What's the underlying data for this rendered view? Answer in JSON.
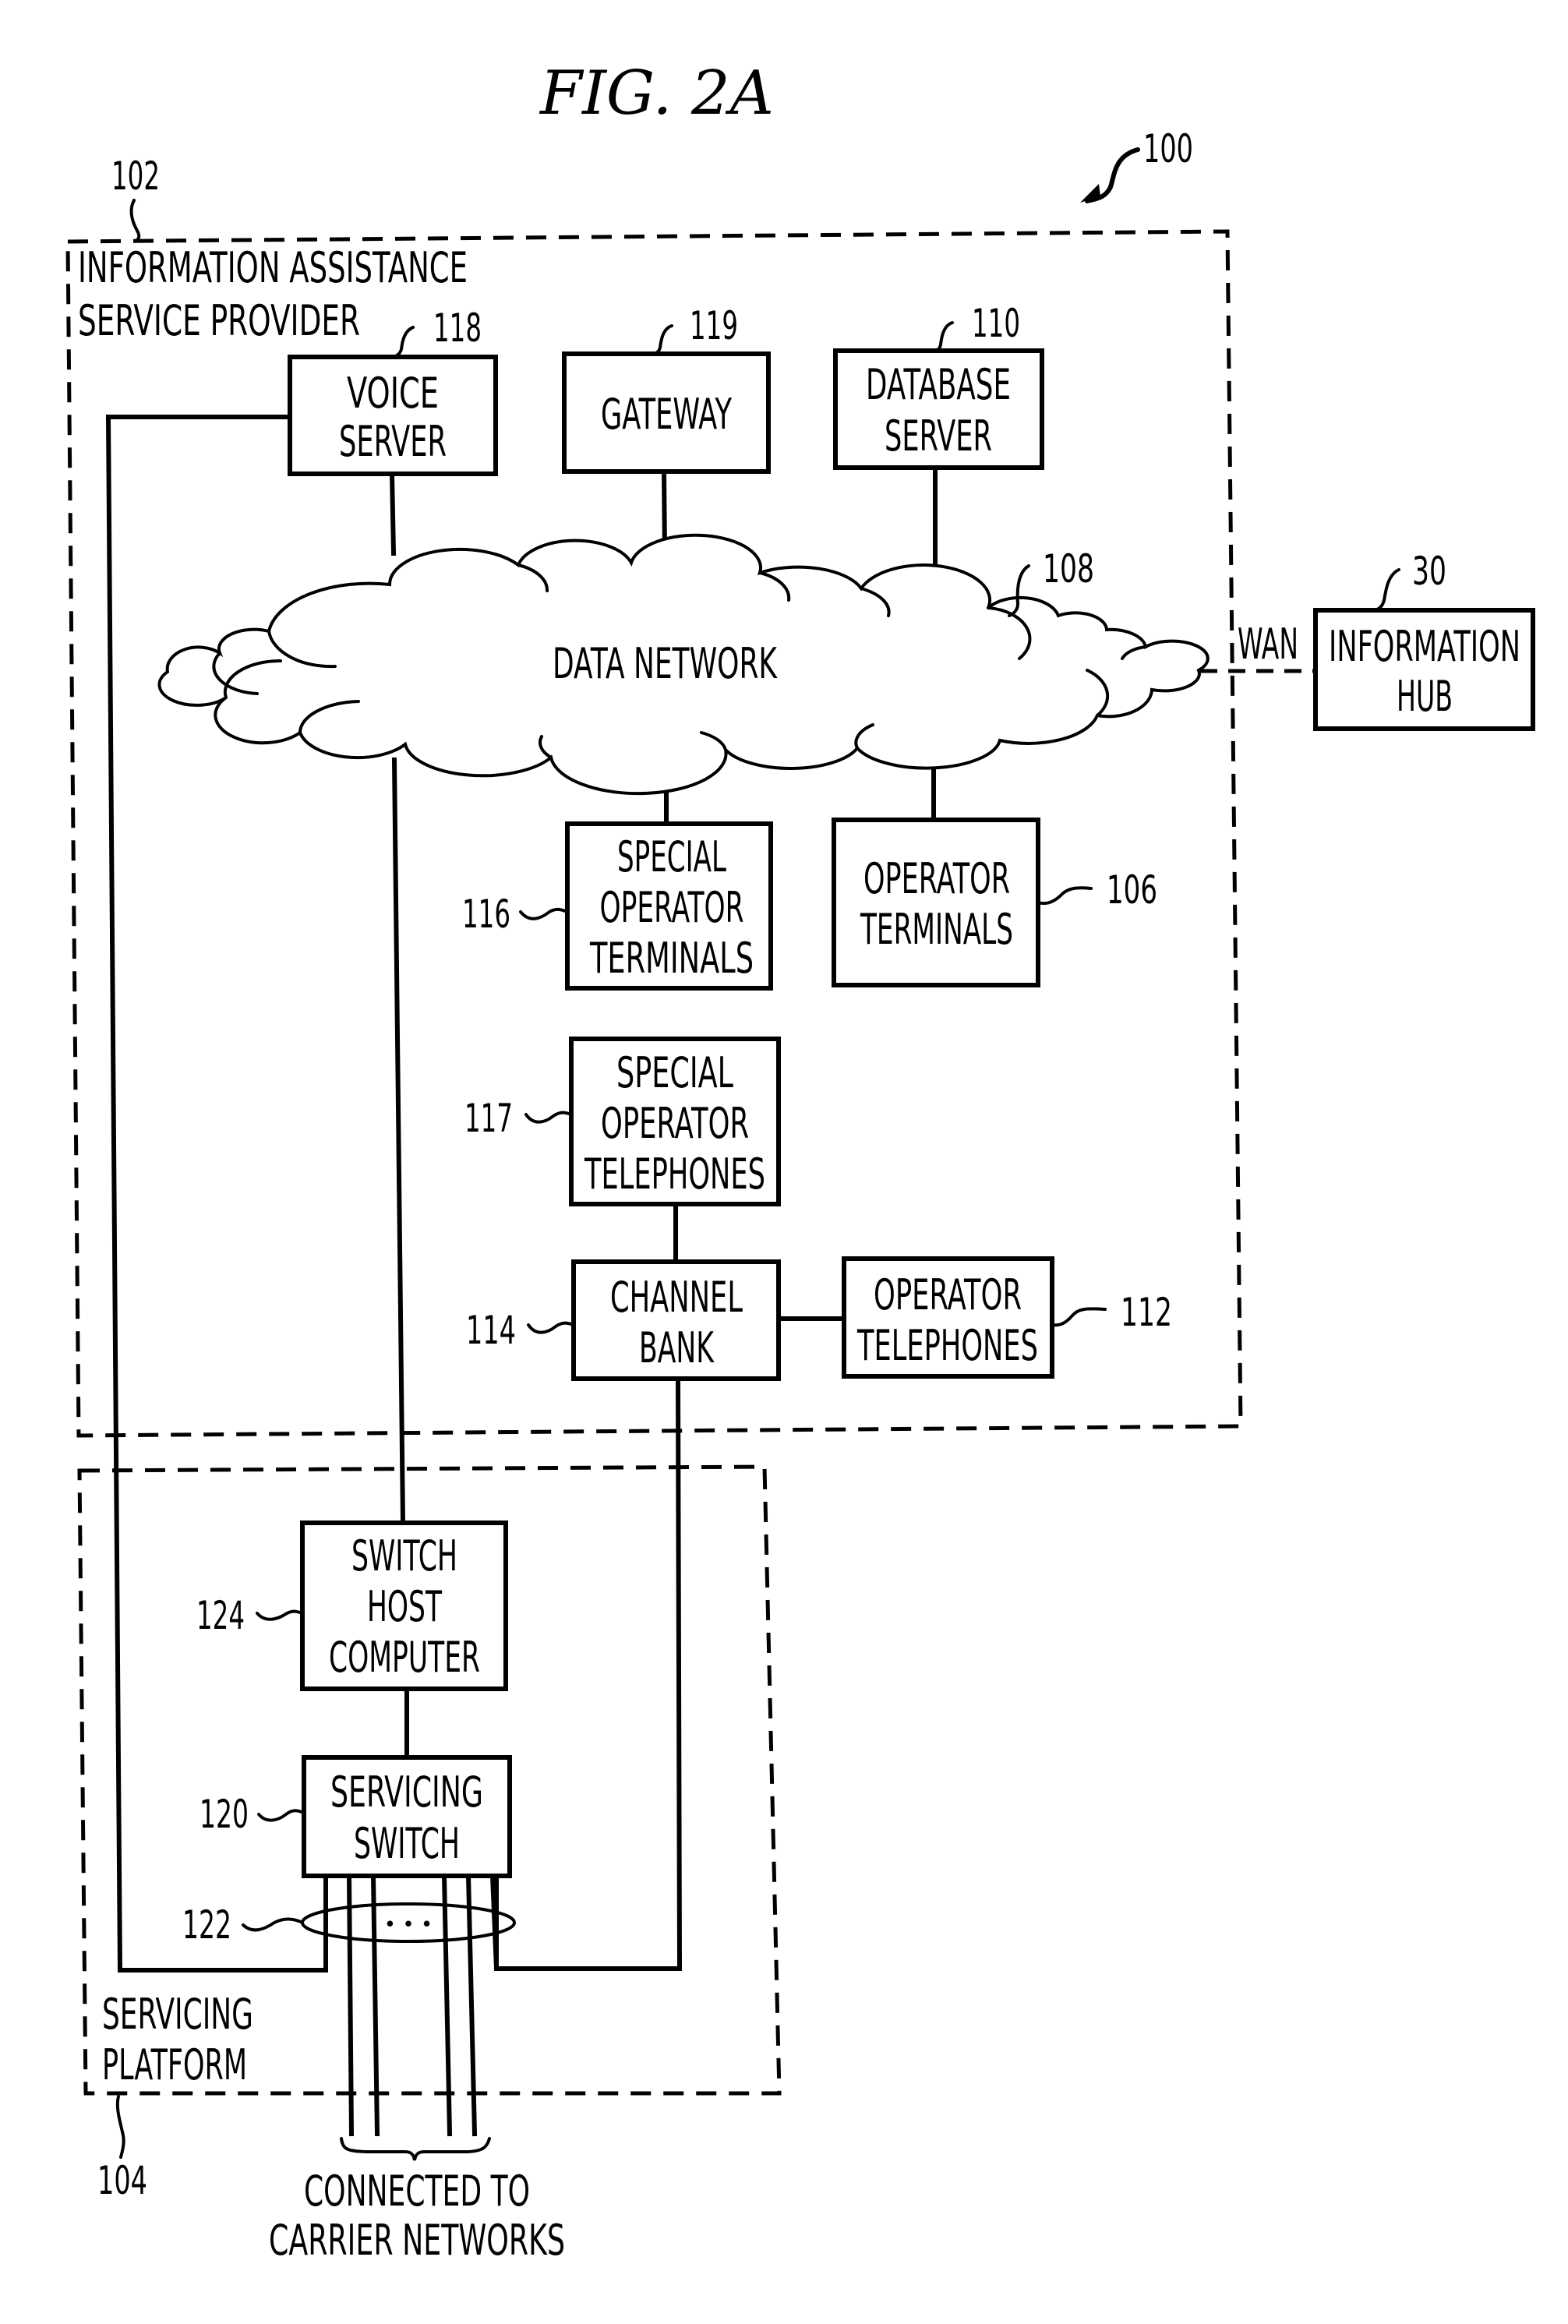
{
  "figure": {
    "title": "FIG. 2A",
    "system_ref": "100"
  },
  "regions": {
    "provider": {
      "ref": "102",
      "label_line1": "INFORMATION ASSISTANCE",
      "label_line2": "SERVICE PROVIDER"
    },
    "platform": {
      "ref": "104",
      "label_line1": "SERVICING",
      "label_line2": "PLATFORM"
    }
  },
  "nodes": {
    "voice_server": {
      "ref": "118",
      "lines": [
        "VOICE",
        "SERVER"
      ]
    },
    "gateway": {
      "ref": "119",
      "lines": [
        "GATEWAY"
      ]
    },
    "database_server": {
      "ref": "110",
      "lines": [
        "DATABASE",
        "SERVER"
      ]
    },
    "data_network": {
      "ref": "108",
      "lines": [
        "DATA NETWORK"
      ]
    },
    "information_hub": {
      "ref": "30",
      "lines": [
        "INFORMATION",
        "HUB"
      ]
    },
    "special_operator_terminals": {
      "ref": "116",
      "lines": [
        "SPECIAL",
        "OPERATOR",
        "TERMINALS"
      ]
    },
    "operator_terminals": {
      "ref": "106",
      "lines": [
        "OPERATOR",
        "TERMINALS"
      ]
    },
    "special_operator_telephones": {
      "ref": "117",
      "lines": [
        "SPECIAL",
        "OPERATOR",
        "TELEPHONES"
      ]
    },
    "channel_bank": {
      "ref": "114",
      "lines": [
        "CHANNEL",
        "BANK"
      ]
    },
    "operator_telephones": {
      "ref": "112",
      "lines": [
        "OPERATOR",
        "TELEPHONES"
      ]
    },
    "switch_host_computer": {
      "ref": "124",
      "lines": [
        "SWITCH",
        "HOST",
        "COMPUTER"
      ]
    },
    "servicing_switch": {
      "ref": "120",
      "lines": [
        "SERVICING",
        "SWITCH"
      ]
    },
    "trunk_bundle": {
      "ref": "122",
      "ellipsis": "• • •"
    }
  },
  "links": {
    "wan_label": "WAN",
    "carrier_line1": "CONNECTED TO",
    "carrier_line2": "CARRIER NETWORKS"
  }
}
